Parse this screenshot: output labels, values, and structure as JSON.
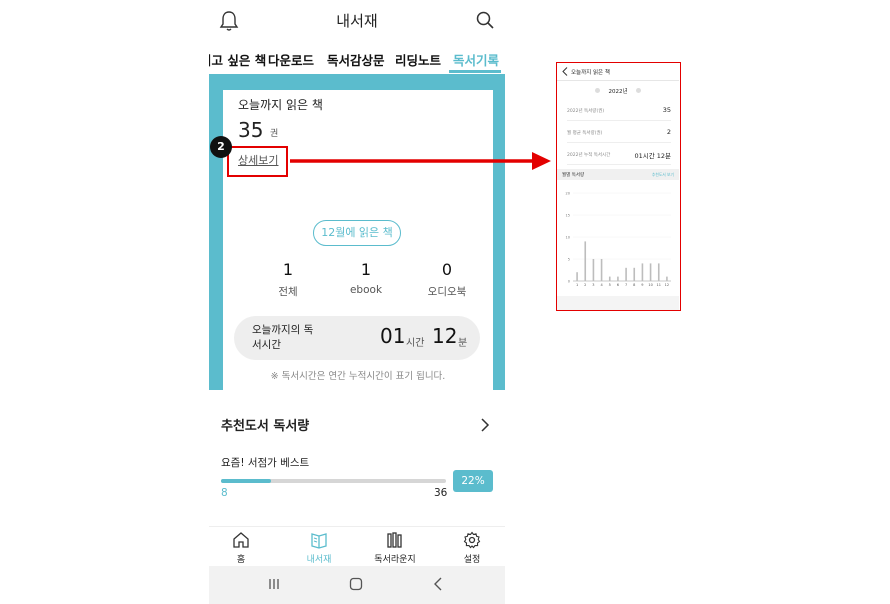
{
  "app": {
    "title": "내서재",
    "tabs": [
      {
        "label": "읽고 싶은 책",
        "active": false
      },
      {
        "label": "다운로드",
        "active": false
      },
      {
        "label": "독서감상문",
        "active": false
      },
      {
        "label": "리딩노트",
        "active": false
      },
      {
        "label": "독서기록",
        "active": true
      }
    ]
  },
  "card": {
    "read_title": "오늘까지 읽은 책",
    "read_count": "35",
    "read_unit": "권",
    "detail_link": "상세보기",
    "month_button": "12월에 읽은 책",
    "stats": [
      {
        "value": "1",
        "label": "전체"
      },
      {
        "value": "1",
        "label": "ebook"
      },
      {
        "value": "0",
        "label": "오디오북"
      }
    ],
    "time_label": "오늘까지의 독서시간",
    "hours": "01",
    "hours_unit": "시간",
    "minutes": "12",
    "minutes_unit": "분",
    "note": "※ 독서시간은 연간 누적시간이 표기 됩니다."
  },
  "recommend": {
    "title": "추천도서 독서량",
    "subtitle": "요즘! 서점가 베스트",
    "progress_fraction": 0.22,
    "min": "8",
    "max": "36",
    "percent_label": "22%"
  },
  "bottom_nav": [
    {
      "label": "홈",
      "icon": "home-icon",
      "active": false
    },
    {
      "label": "내서재",
      "icon": "library-icon",
      "active": true
    },
    {
      "label": "독서라운지",
      "icon": "lounge-icon",
      "active": false
    },
    {
      "label": "설정",
      "icon": "gear-icon",
      "active": false
    }
  ],
  "annotation": {
    "step": "2",
    "color": "#e30000"
  },
  "thumbnail": {
    "title": "오늘까지 읽은 책",
    "year": "2022년",
    "rows": [
      {
        "key": "2022년 독서량(권)",
        "value": "35"
      },
      {
        "key": "월 평균 독서량(권)",
        "value": "2"
      },
      {
        "key": "2022년 누적 독서시간",
        "value": "01시간 12분"
      }
    ],
    "band_label": "월별 독서량",
    "band_link": "추천도서 보기",
    "chart_data": {
      "type": "bar",
      "categories": [
        "1",
        "2",
        "3",
        "4",
        "5",
        "6",
        "7",
        "8",
        "9",
        "10",
        "11",
        "12"
      ],
      "values": [
        2,
        9,
        5,
        5,
        1,
        1,
        3,
        3,
        4,
        4,
        4,
        1
      ],
      "ylim": [
        0,
        20
      ],
      "yticks": [
        "0",
        "5",
        "10",
        "15",
        "20"
      ]
    }
  },
  "colors": {
    "accent": "#5bbccd",
    "highlight": "#e30000"
  }
}
